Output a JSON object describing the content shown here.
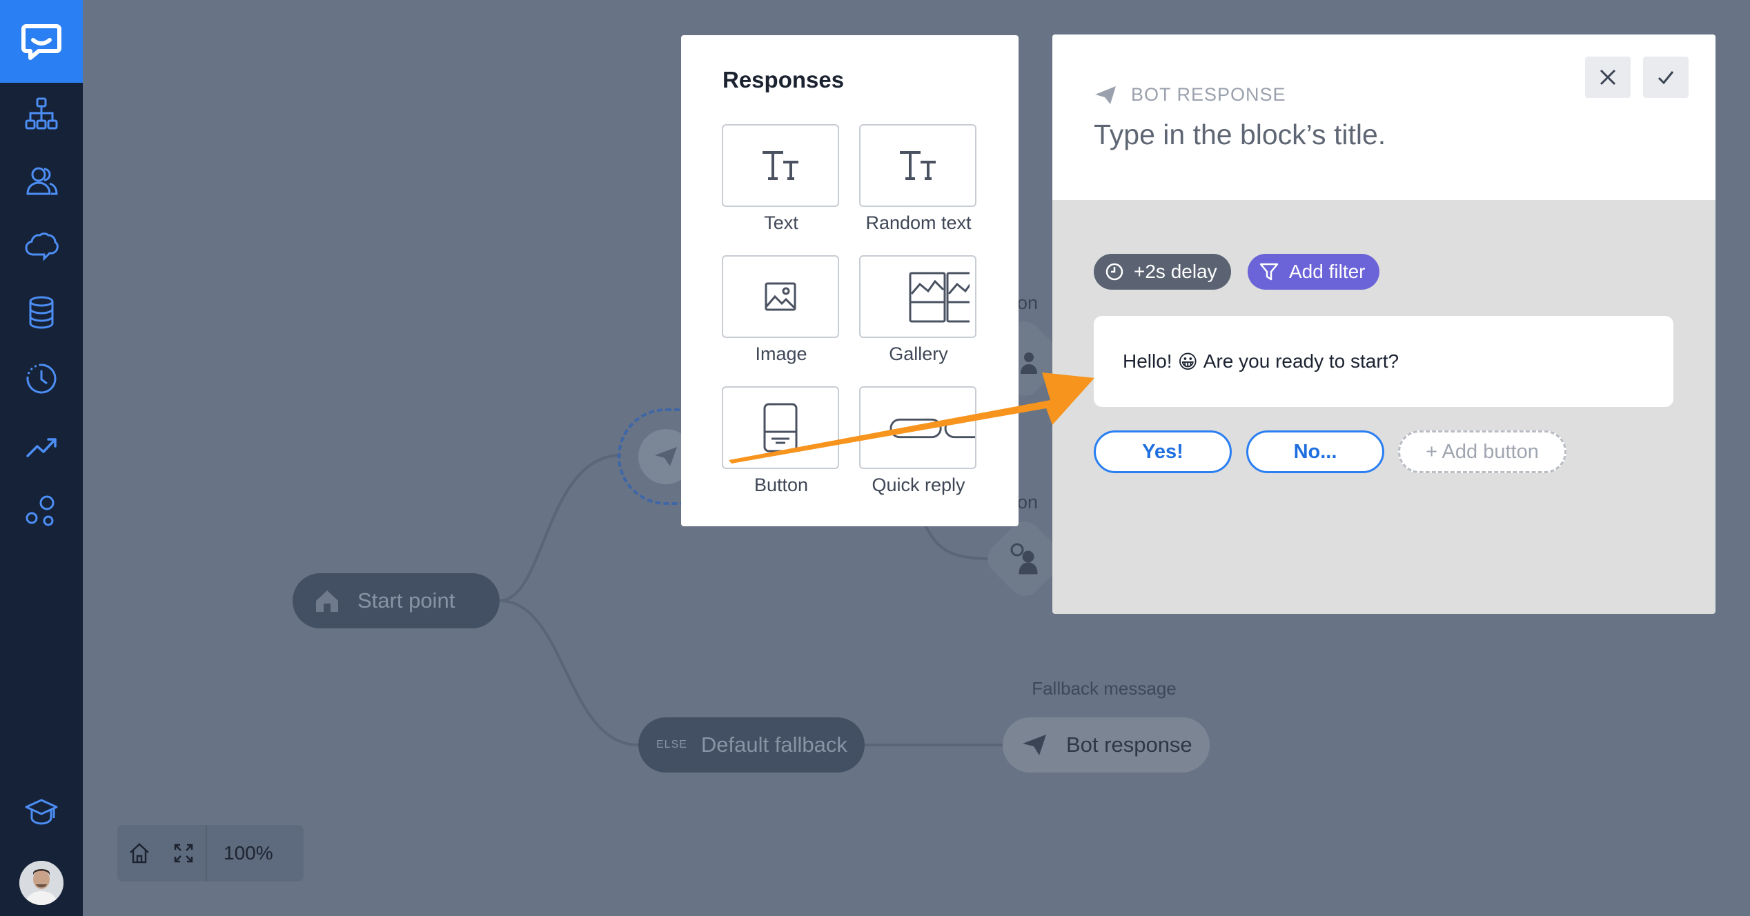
{
  "canvas": {
    "start_point": "Start point",
    "default_fallback_tag": "ELSE",
    "default_fallback": "Default fallback",
    "fallback_label": "Fallback message",
    "bot_response_node": "Bot response",
    "faded_label_1": "ion",
    "faded_label_2": "ion"
  },
  "zoom": {
    "level": "100%"
  },
  "responses_panel": {
    "title": "Responses",
    "items": [
      {
        "label": "Text"
      },
      {
        "label": "Random text"
      },
      {
        "label": "Image"
      },
      {
        "label": "Gallery"
      },
      {
        "label": "Button"
      },
      {
        "label": "Quick reply"
      }
    ]
  },
  "editor": {
    "kind": "BOT RESPONSE",
    "title_placeholder": "Type in the block’s title.",
    "delay": "+2s delay",
    "filter": "Add filter",
    "message_before": "Hello!",
    "message_emoji": "😀",
    "message_after": "Are you ready to start?",
    "buttons": [
      {
        "label": "Yes!"
      },
      {
        "label": "No..."
      }
    ],
    "add_button": "+ Add button"
  },
  "colors": {
    "sidebar": "#152238",
    "accent": "#2a7ff2",
    "filter": "#6b63d8",
    "arrow": "#f7941d"
  }
}
